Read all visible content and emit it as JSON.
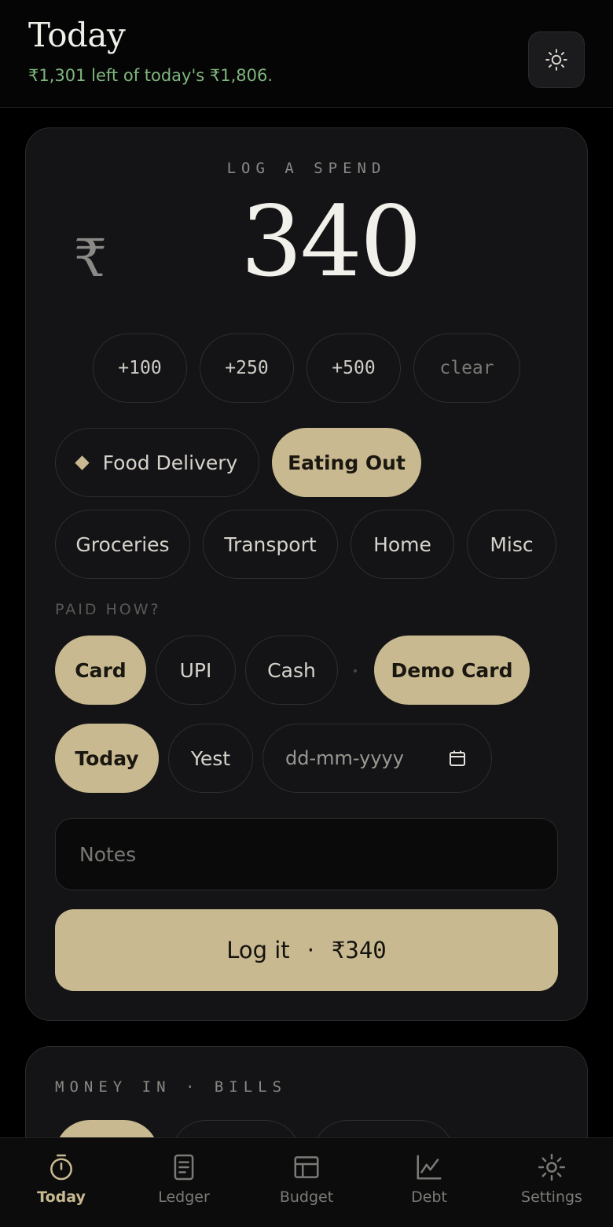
{
  "header": {
    "title": "Today",
    "subtitle": "₹1,301 left of today's ₹1,806.",
    "theme_icon": "sun-icon"
  },
  "log": {
    "label": "LOG A SPEND",
    "currency_symbol": "₹",
    "amount": "340",
    "quick_adds": [
      "+100",
      "+250",
      "+500",
      "clear"
    ]
  },
  "categories": {
    "items": [
      "Food Delivery",
      "Eating Out",
      "Groceries",
      "Transport",
      "Home",
      "Misc"
    ],
    "selected": "Eating Out"
  },
  "payment": {
    "label": "PAID HOW?",
    "methods": [
      "Card",
      "UPI",
      "Cash"
    ],
    "selected_method": "Card",
    "card_name": "Demo Card"
  },
  "date": {
    "options": [
      "Today",
      "Yest"
    ],
    "selected": "Today",
    "placeholder": "dd-mm-yyyy"
  },
  "notes": {
    "placeholder": "Notes"
  },
  "submit": {
    "label": "Log it",
    "separator": "·",
    "amount": "₹340"
  },
  "money_in": {
    "label": "MONEY IN · BILLS"
  },
  "nav": {
    "items": [
      {
        "label": "Today",
        "icon": "timer-icon",
        "active": true
      },
      {
        "label": "Ledger",
        "icon": "document-icon",
        "active": false
      },
      {
        "label": "Budget",
        "icon": "grid-icon",
        "active": false
      },
      {
        "label": "Debt",
        "icon": "chart-line-icon",
        "active": false
      },
      {
        "label": "Settings",
        "icon": "gear-icon",
        "active": false
      }
    ]
  },
  "colors": {
    "accent": "#c8b990",
    "positive": "#7fb77e",
    "background": "#000000",
    "card": "#141416"
  }
}
